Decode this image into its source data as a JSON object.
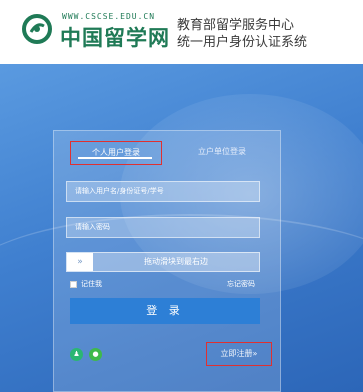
{
  "header": {
    "site_url": "WWW.CSCSE.EDU.CN",
    "site_name": "中国留学网",
    "title_line1": "教育部留学服务中心",
    "title_line2": "统一用户身份认证系统"
  },
  "login": {
    "tabs": [
      {
        "label": "个人用户登录",
        "active": true
      },
      {
        "label": "立户单位登录",
        "active": false
      }
    ],
    "username_placeholder": "请输入用户名/身份证号/学号",
    "password_placeholder": "请输入密码",
    "slider_text": "拖动滑块到最右边",
    "slider_handle": "»",
    "remember_label": "记住我",
    "forgot_label": "忘记密码",
    "submit_label": "登 录",
    "register_label": "立即注册»"
  },
  "colors": {
    "brand_green": "#1f7a56",
    "background_blue": "#3f7fcf",
    "button_blue": "#2d7fd6",
    "highlight_red": "#e03030"
  },
  "icons": {
    "logo": "cscse-logo-icon",
    "qq": "qq-icon",
    "wechat": "wechat-icon"
  }
}
